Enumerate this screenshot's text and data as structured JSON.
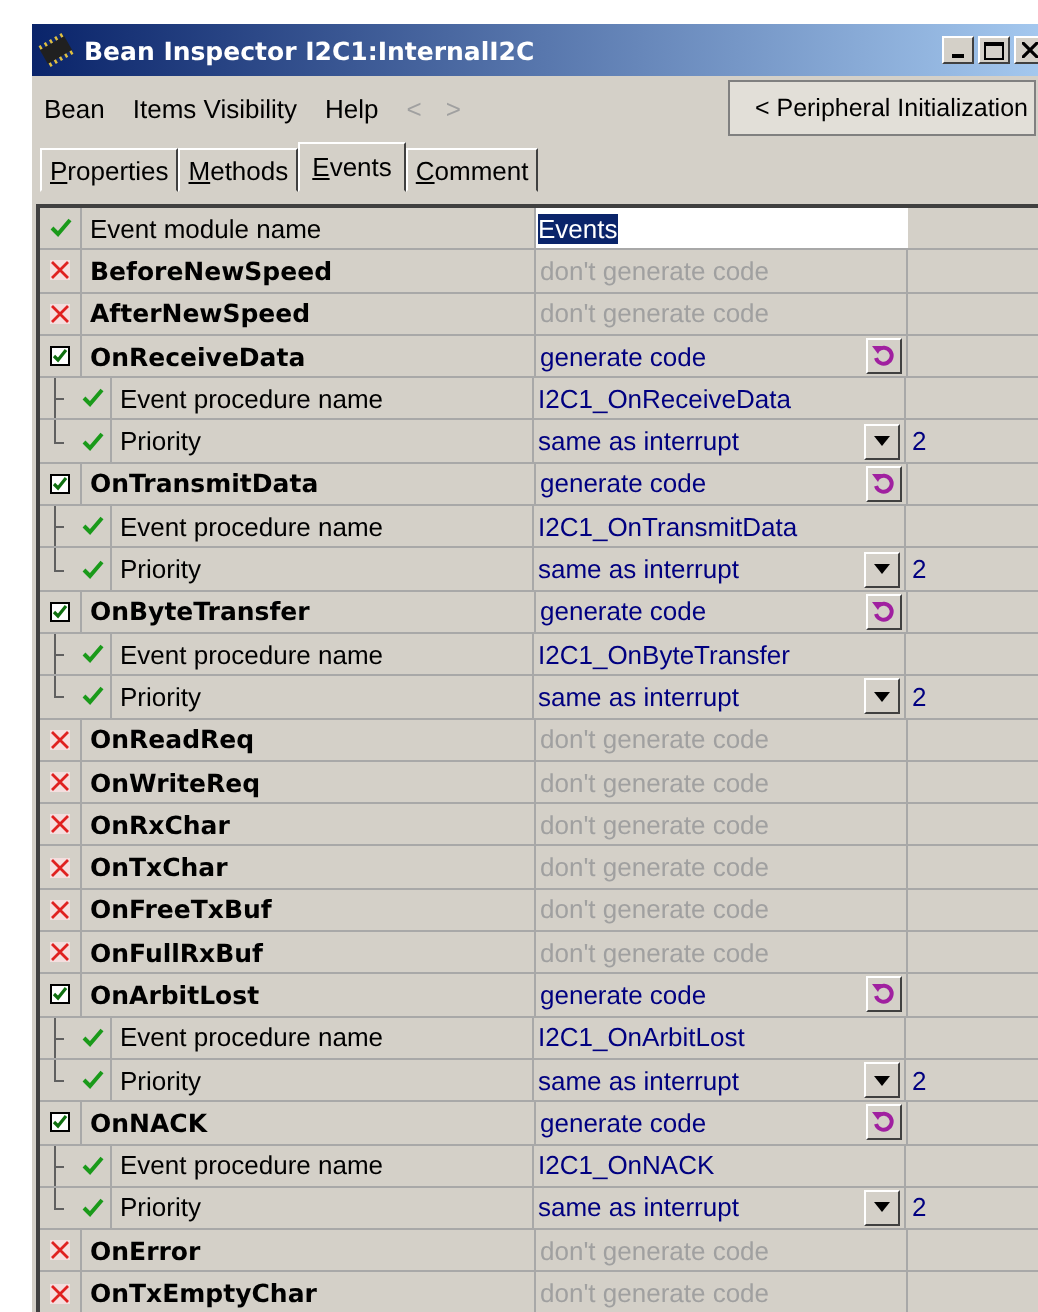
{
  "window": {
    "title": "Bean Inspector I2C1:InternalI2C"
  },
  "menu": [
    {
      "label": "Bean"
    },
    {
      "label": "Items Visibility"
    },
    {
      "label": "Help"
    }
  ],
  "nav": [
    {
      "label": "<",
      "disabled": true
    },
    {
      "label": ">",
      "disabled": true
    }
  ],
  "mode_button": {
    "label": "< Peripheral Initialization"
  },
  "tabs": [
    {
      "label": "Properties",
      "selected": false
    },
    {
      "label": "Methods",
      "selected": false
    },
    {
      "label": "Events",
      "selected": true
    },
    {
      "label": "Comment",
      "selected": false
    }
  ],
  "rows": [
    {
      "kind": "module",
      "name": "Event module name",
      "value": "Events"
    },
    {
      "kind": "event",
      "name": "BeforeNewSpeed",
      "enabled": false,
      "value": "don't generate code"
    },
    {
      "kind": "event",
      "name": "AfterNewSpeed",
      "enabled": false,
      "value": "don't generate code"
    },
    {
      "kind": "event",
      "name": "OnReceiveData",
      "enabled": true,
      "value": "generate code",
      "children": [
        {
          "kind": "text",
          "name": "Event procedure name",
          "value": "I2C1_OnReceiveData"
        },
        {
          "kind": "choice",
          "name": "Priority",
          "value": "same as interrupt",
          "extra": "2"
        }
      ]
    },
    {
      "kind": "event",
      "name": "OnTransmitData",
      "enabled": true,
      "value": "generate code",
      "children": [
        {
          "kind": "text",
          "name": "Event procedure name",
          "value": "I2C1_OnTransmitData"
        },
        {
          "kind": "choice",
          "name": "Priority",
          "value": "same as interrupt",
          "extra": "2"
        }
      ]
    },
    {
      "kind": "event",
      "name": "OnByteTransfer",
      "enabled": true,
      "value": "generate code",
      "children": [
        {
          "kind": "text",
          "name": "Event procedure name",
          "value": "I2C1_OnByteTransfer"
        },
        {
          "kind": "choice",
          "name": "Priority",
          "value": "same as interrupt",
          "extra": "2"
        }
      ]
    },
    {
      "kind": "event",
      "name": "OnReadReq",
      "enabled": false,
      "value": "don't generate code"
    },
    {
      "kind": "event",
      "name": "OnWriteReq",
      "enabled": false,
      "value": "don't generate code"
    },
    {
      "kind": "event",
      "name": "OnRxChar",
      "enabled": false,
      "value": "don't generate code"
    },
    {
      "kind": "event",
      "name": "OnTxChar",
      "enabled": false,
      "value": "don't generate code"
    },
    {
      "kind": "event",
      "name": "OnFreeTxBuf",
      "enabled": false,
      "value": "don't generate code"
    },
    {
      "kind": "event",
      "name": "OnFullRxBuf",
      "enabled": false,
      "value": "don't generate code"
    },
    {
      "kind": "event",
      "name": "OnArbitLost",
      "enabled": true,
      "value": "generate code",
      "children": [
        {
          "kind": "text",
          "name": "Event procedure name",
          "value": "I2C1_OnArbitLost"
        },
        {
          "kind": "choice",
          "name": "Priority",
          "value": "same as interrupt",
          "extra": "2"
        }
      ]
    },
    {
      "kind": "event",
      "name": "OnNACK",
      "enabled": true,
      "value": "generate code",
      "children": [
        {
          "kind": "text",
          "name": "Event procedure name",
          "value": "I2C1_OnNACK"
        },
        {
          "kind": "choice",
          "name": "Priority",
          "value": "same as interrupt",
          "extra": "2"
        }
      ]
    },
    {
      "kind": "event",
      "name": "OnError",
      "enabled": false,
      "value": "don't generate code"
    },
    {
      "kind": "event",
      "name": "OnTxEmptyChar",
      "enabled": false,
      "value": "don't generate code"
    }
  ]
}
